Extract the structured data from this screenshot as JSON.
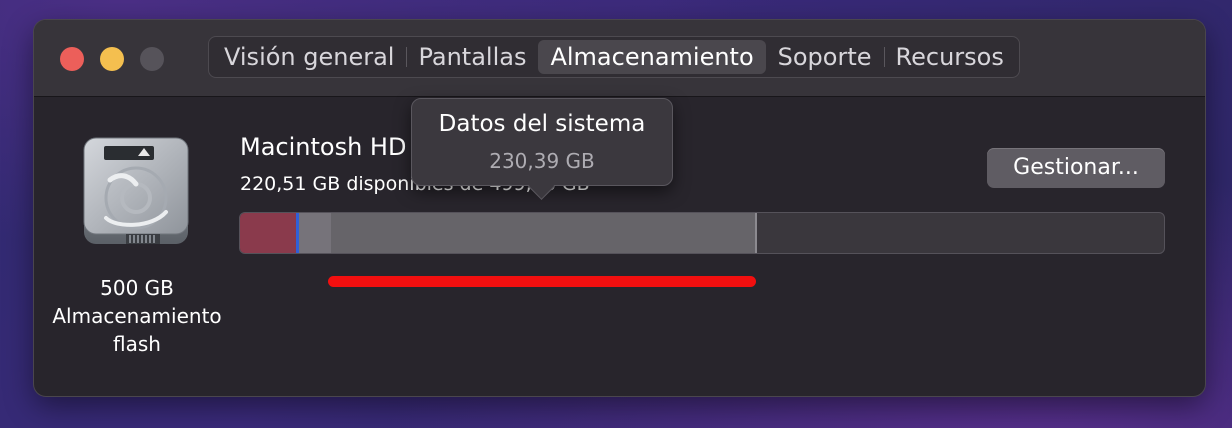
{
  "tabs": [
    {
      "label": "Visión general",
      "active": false
    },
    {
      "label": "Pantallas",
      "active": false
    },
    {
      "label": "Almacenamiento",
      "active": true
    },
    {
      "label": "Soporte",
      "active": false
    },
    {
      "label": "Recursos",
      "active": false
    }
  ],
  "disk": {
    "icon": "internal-hard-drive-icon",
    "caption_line1": "500 GB",
    "caption_line2": "Almacenamiento",
    "caption_line3": "flash"
  },
  "volume": {
    "name": "Macintosh HD",
    "availability": "220,51 GB disponibles de 499,96 GB"
  },
  "manage_button": {
    "label": "Gestionar..."
  },
  "tooltip": {
    "title": "Datos del sistema",
    "size": "230,39 GB"
  },
  "storage_bar": {
    "segments": [
      {
        "name": "apps",
        "color": "#8a3a4c"
      },
      {
        "name": "documents",
        "color": "#3060d8"
      },
      {
        "name": "other",
        "color": "#76737a"
      },
      {
        "name": "system-data",
        "color": "#666469"
      }
    ],
    "free_color": "#3a373d"
  },
  "colors": {
    "close": "#ec5f5a",
    "minimize": "#f4bf4f",
    "zoom_disabled": "#56535a",
    "annotation_line": "#f20f0f"
  }
}
